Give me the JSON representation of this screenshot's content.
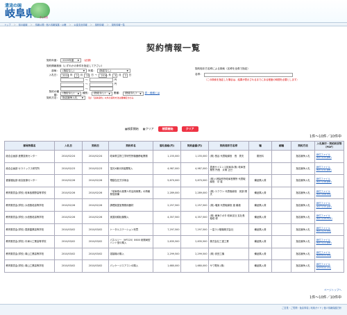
{
  "header": {
    "logo_top": "清流の国",
    "logo_main": "岐阜県",
    "tagline": "ぎふ清流"
  },
  "nav": [
    "トップ",
    "県の組織",
    "情報公開・個人情報保護・公聴",
    "公金支出情報",
    "契約情報",
    "契約情報一覧"
  ],
  "page_title": "契約情報一覧",
  "form": {
    "fiscal_year_label": "契約年度：",
    "fiscal_year_value": "2009年度",
    "required": "（必須）",
    "left_section_title": "契約情報検索（いずれかの条件を指定して下さい）",
    "division_label": "部局：",
    "division_value": "(指定なし)",
    "office_label": "所属：",
    "office_value": "(指定なし)",
    "date_label": "入札日：",
    "date_from": [
      "2010",
      "2",
      "23"
    ],
    "date_to": [
      "2010",
      "3",
      "2"
    ],
    "date_sep": "～",
    "unit_year": "年",
    "unit_month": "月",
    "unit_day": "日",
    "range_sep": "～",
    "yen": "円",
    "contract_label": "契約の種類：",
    "contract_value": "(指定なし)",
    "category_label": "種別：",
    "category_value": "(指定なし)",
    "ctype_label": "業種：",
    "ctype_value": "(指定なし)",
    "detail_link": "詳・細細とは",
    "method_label": "契約方法：",
    "method_value": "指名競争入札",
    "method_note": "（注）「競争契約」以外の契約方法は業種区分のみ",
    "right_section_title": "契約相手方名称による検索（名称を全角で指定）",
    "name_label": "名称：",
    "name_note": "（この検索を指定した場合は、結果が表示されるまでにある程度の時間を必要とします）"
  },
  "buttons": {
    "search_icon_text": "検索開始",
    "clear_icon_text": "クリア",
    "search": "検索開始",
    "clear": "クリア"
  },
  "count_top": "1件～10件／10件中",
  "count_bottom": "1件～10件／10件中",
  "pagination": "ページトップへ",
  "table": {
    "headers": [
      "部局所属名",
      "入札日",
      "契約日",
      "契約件名",
      "落札価格(円)",
      "契約金額(円)",
      "契約相手方名称",
      "種",
      "細種",
      "契約方法",
      "入札執行・契約状況等（PDF）"
    ],
    "rows": [
      [
        "総合企画部 産業技術センター",
        "2010/02/24",
        "2010/02/24",
        "岐阜県生物工学研究所機器移転業務",
        "1,155,000",
        "1,155,000",
        "(株) 長谷 代表取締役　長　秀夫",
        "委託料",
        "",
        "指名競争入札",
        "添付ファイル(K07105.pdf)"
      ],
      [
        "総合企画部 セラミックス研究所",
        "2010/02/23",
        "2010/02/23",
        "蛍光X線分析装置購入",
        "4,987,000",
        "4,987,000",
        "恵進サイエンス岐阜本(株) 岐阜営業所 所長　片桐 正巳",
        "",
        "",
        "指名競争入札",
        "添付ファイル(K07131.pdf)"
      ],
      [
        "健康福祉部 総合医療センター",
        "2010/02/26",
        "2010/02/26",
        "電動血圧式手術台",
        "5,670,000",
        "5,670,000",
        "(株)八神製作所岐阜営業所 代表取締役　中 達",
        "備品購入費",
        "",
        "指名競争入札",
        "添付ファイル(K07138.pdf)"
      ],
      [
        "教育委員会(学校) 岐阜各務野高等学校",
        "2010/02/26",
        "2010/02/26",
        "「岐阜県の産業人材活用事業」の情報発信設備",
        "2,289,000",
        "2,289,000",
        "(株) エクウン 代表取締役　安部 陽夫",
        "備品購入費",
        "",
        "指名競争入札",
        "添付ファイル(K07148.xls)"
      ],
      [
        "教育委員会(学校) 大垣養老高等学校",
        "2010/02/26",
        "2010/02/26",
        "調理実習室業務用器材",
        "2,257,500",
        "2,257,500",
        "(株) 増淵 代表取締役 渡 義雄",
        "備品購入費",
        "",
        "指名競争入札",
        "添付ファイル(K07135.pdf)"
      ],
      [
        "教育委員会(学校) 大垣養老高等学校",
        "2010/02/26",
        "2010/02/26",
        "実習用耕耘機購入",
        "4,357,500",
        "4,357,500",
        "(株) 東海クボタ 岐阜支社 支社長　稲垣 修",
        "備品購入費",
        "",
        "指名競争入札",
        "添付ファイル(K07139.PDF)"
      ],
      [
        "教育委員会(学校) 恵那農業高等学校",
        "2010/03/02",
        "2010/03/02",
        "トータルステーション売買",
        "7,297,500",
        "7,297,500",
        "一富ラジ樹機株式会社",
        "備品購入費",
        "",
        "指名競争入札",
        "添付ファイル(K07125.xls)"
      ],
      [
        "教育委員会(学校) 中津川工業高等学校",
        "2010/03/02",
        "2010/03/02",
        "パネルソー（HP220）8600 総務局型 バンド型の購入",
        "2,635,500",
        "2,635,500",
        "株式会社三重工業",
        "備品購入費",
        "",
        "指名競争入札",
        "添付ファイル(K07122.pdf)"
      ],
      [
        "教育委員会(学校) 萬山工業高等学校",
        "2010/03/02",
        "2010/03/02",
        "溶接機の購入",
        "2,299,500",
        "2,299,500",
        "(株) 安田工機",
        "備品購入費",
        "",
        "指名競争入札",
        "添付ファイル(K09503.xls)"
      ],
      [
        "教育委員会(学校) 萬山工業高等学校",
        "2010/03/02",
        "2010/03/02",
        "パッケージエアコンの購入",
        "1,680,000",
        "1,680,000",
        "サワ電気 (株)",
        "備品購入費",
        "",
        "指名競争入札",
        "添付ファイル(K09504.xls)"
      ]
    ]
  },
  "footer": {
    "links": "ご意見・ご質問・免責事項 | 利用ガイド | 個人情報保護方針"
  },
  "colors": {
    "accent": "#1a5ea8",
    "button": "#ee3344",
    "header_bg": "#e6eef8"
  }
}
